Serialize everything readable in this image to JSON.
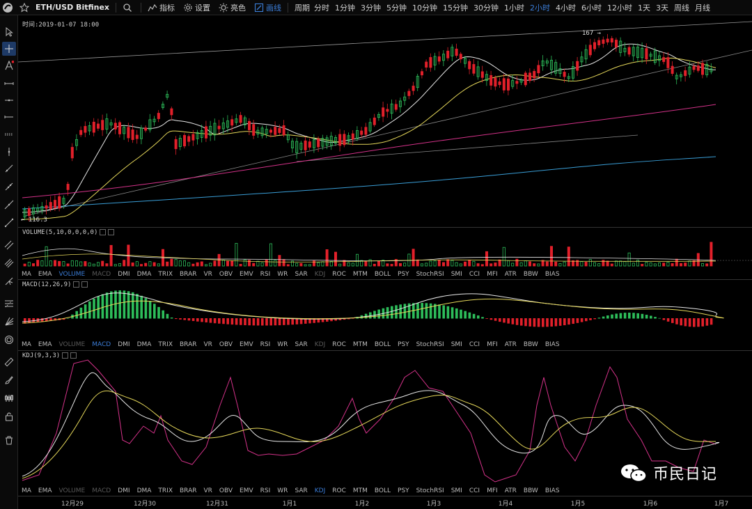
{
  "toolbar": {
    "symbol": "ETH/USD Bitfinex",
    "indicators_label": "指标",
    "settings_label": "设置",
    "theme_label": "亮色",
    "draw_label": "画线",
    "period_label": "周期",
    "periods": [
      "分时",
      "1分钟",
      "3分钟",
      "5分钟",
      "10分钟",
      "15分钟",
      "30分钟",
      "1小时",
      "2小时",
      "4小时",
      "6小时",
      "12小时",
      "1天",
      "3天",
      "周线",
      "月线"
    ],
    "active_period": "2小时"
  },
  "main_pane": {
    "time_label": "时间:2019-01-07 18:00",
    "high_label": "167 →",
    "low_label": "← 116.3"
  },
  "volume_pane": {
    "label": "VOLUME(5,10,0,0,0,0)"
  },
  "macd_pane": {
    "label": "MACD(12,26,9)"
  },
  "kdj_pane": {
    "label": "KDJ(9,3,3)"
  },
  "indicator_tabs": [
    "MA",
    "EMA",
    "VOLUME",
    "MACD",
    "DMI",
    "DMA",
    "TRIX",
    "BRAR",
    "VR",
    "OBV",
    "EMV",
    "RSI",
    "WR",
    "SAR",
    "KDJ",
    "ROC",
    "MTM",
    "BOLL",
    "PSY",
    "StochRSI",
    "SMI",
    "CCI",
    "MFI",
    "ATR",
    "BBW",
    "BIAS"
  ],
  "x_axis": [
    "12月29",
    "12月30",
    "12月31",
    "1月1",
    "1月2",
    "1月3",
    "1月4",
    "1月5",
    "1月6",
    "1月7"
  ],
  "watermark": "币民日记",
  "colors": {
    "up": "#2dbd5a",
    "down": "#e2202a",
    "active": "#3b7dd8",
    "ma_white": "#e8e8e8",
    "ma_yellow": "#e6d85a",
    "ma_pink": "#d5328a",
    "ma_blue": "#3a9fd8"
  }
}
